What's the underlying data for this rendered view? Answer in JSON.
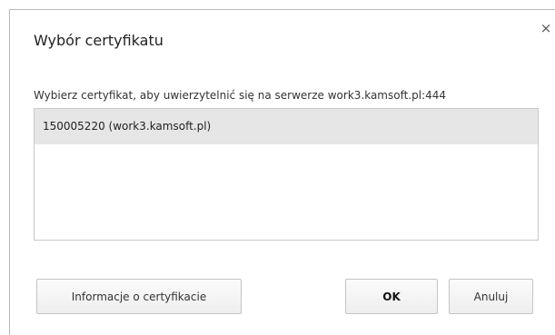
{
  "dialog": {
    "title": "Wybór certyfikatu",
    "close_glyph": "×",
    "prompt": "Wybierz certyfikat, aby uwierzytelnić się na serwerze work3.kamsoft.pl:444",
    "certificates": [
      {
        "label": "150005220 (work3.kamsoft.pl)",
        "selected": true
      }
    ],
    "buttons": {
      "info_label": "Informacje o certyfikacie",
      "ok_label": "OK",
      "cancel_label": "Anuluj"
    }
  },
  "colors": {
    "selected_row": "#e6e6e6",
    "border": "#c8c8c8"
  }
}
